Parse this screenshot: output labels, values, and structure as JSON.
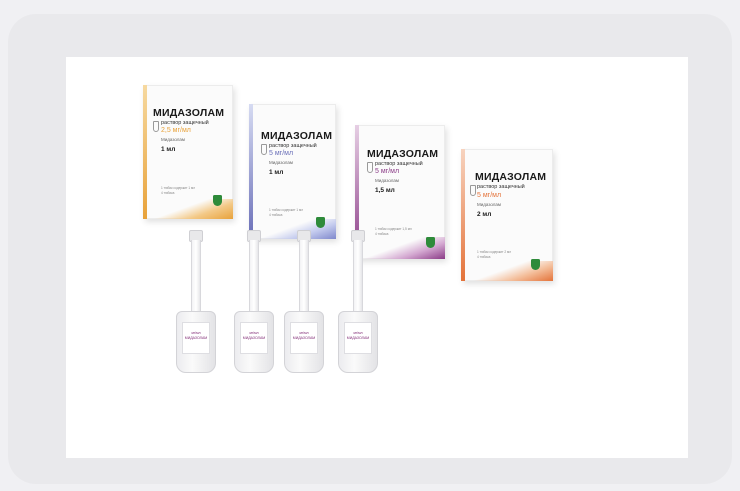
{
  "boxes": [
    {
      "title": "МИДАЗОЛАМ",
      "subtitle": "раствор защечный",
      "dose": "2,5 мг/мл",
      "inn": "Мидазолам",
      "volume": "1 мл",
      "fine1": "1 тюбик содержит 1 мл",
      "fine2": "4 тюбика",
      "accent": "#e8a23a",
      "band": "#efc06a"
    },
    {
      "title": "МИДАЗОЛАМ",
      "subtitle": "раствор защечный",
      "dose": "5 мг/мл",
      "inn": "Мидазолам",
      "volume": "1 мл",
      "fine1": "1 тюбик содержит 1 мл",
      "fine2": "4 тюбика",
      "accent": "#6a6fb8",
      "band": "#9aa6dc"
    },
    {
      "title": "МИДАЗОЛАМ",
      "subtitle": "раствор защечный",
      "dose": "5 мг/мл",
      "inn": "Мидазолам",
      "volume": "1,5 мл",
      "fine1": "1 тюбик содержит 1,5 мл",
      "fine2": "4 тюбика",
      "accent": "#8a3a86",
      "band": "#b46fb0"
    },
    {
      "title": "МИДАЗОЛАМ",
      "subtitle": "раствор защечный",
      "dose": "5 мг/мл",
      "inn": "Мидазолам",
      "volume": "2 мл",
      "fine1": "1 тюбик содержит 2 мл",
      "fine2": "4 тюбика",
      "accent": "#e4733a",
      "band": "#f0a070"
    }
  ],
  "ampoules": [
    {
      "label1": "мг/мл",
      "label2": "МИДАЗОЛАМ"
    },
    {
      "label1": "мг/мл",
      "label2": "МИДАЗОЛАМ"
    },
    {
      "label1": "мг/мл",
      "label2": "МИДАЗОЛАМ"
    },
    {
      "label1": "мг/мл",
      "label2": "МИДАЗОЛАМ"
    }
  ],
  "colors": {
    "emblem": "#2e8b3a",
    "page_bg": "#f0f0f3",
    "frame": "#e9e9ec"
  }
}
